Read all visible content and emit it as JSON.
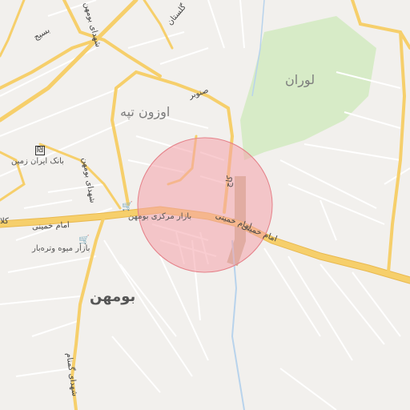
{
  "map": {
    "colors": {
      "background": "#f2f0ed",
      "major_road": "#f6cf6b",
      "major_road_casing": "#e9b94f",
      "minor_road": "#ffffff",
      "park": "#d7ebc7",
      "highway": "#c9b99a",
      "river": "#b8d3ec",
      "highlight_fill": "#f4a3a9",
      "highlight_stroke": "#e58088"
    },
    "highlight_circle": {
      "opacity": 0.55
    },
    "labels": {
      "bumehen": "بومهن",
      "ouzun_tappeh": "اوزون تپه",
      "luran": "لوران",
      "emam_khomeini_1": "امام خمینی",
      "emam_khomeini_2": "امام خمینی",
      "emam_khomeini_left": "امام خمینی",
      "bazar": "بازار مرکزی بومهن",
      "bank": "بانک ایران زمین",
      "fruit_market": "بازار میوه وتره‌بار",
      "shohada": "شهدای بومهن",
      "senobar": "صنوبر",
      "pasij": "بسیج",
      "shohada_top": "شهدای بومهن",
      "golestan": "گلستان",
      "kaj": "کاج",
      "road_bottom_left": "شهدای گمنام",
      "left_edge": "کلا"
    },
    "icons": {
      "bank": "bank-icon",
      "cart_1": "shopping-cart-icon",
      "cart_2": "shopping-cart-icon"
    }
  }
}
